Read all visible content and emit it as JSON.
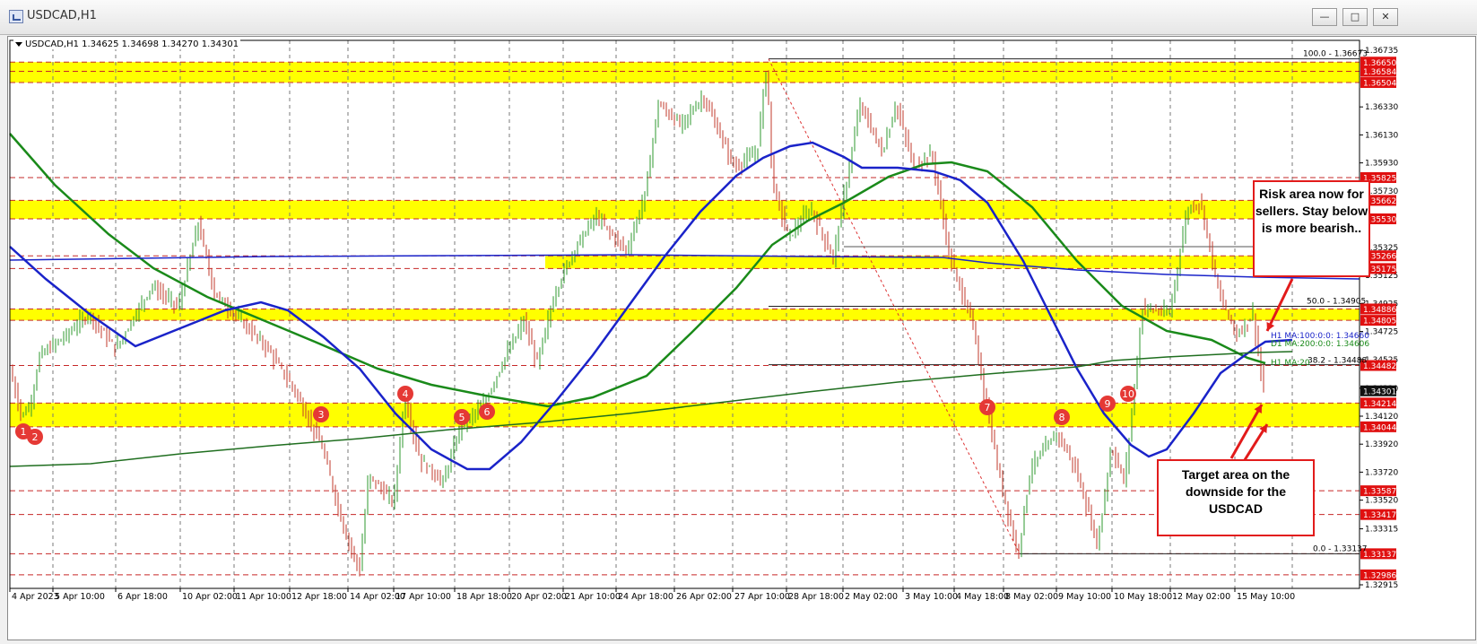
{
  "window": {
    "title": "USDCAD,H1",
    "buttons": [
      "minimize",
      "maximize",
      "close"
    ],
    "minimize_glyph": "—",
    "maximize_glyph": "□",
    "close_glyph": "✕"
  },
  "chart": {
    "info_line": "USDCAD,H1  1.34625 1.34698 1.34270 1.34301",
    "y_ticks": [
      "1.36735",
      "1.36330",
      "1.36130",
      "1.35930",
      "1.35730",
      "1.35325",
      "1.35125",
      "1.34925",
      "1.34725",
      "1.34525",
      "1.34320",
      "1.34120",
      "1.33920",
      "1.33720",
      "1.33520",
      "1.33315",
      "1.32915"
    ],
    "x_ticks": [
      "4 Apr 2023",
      "5 Apr 10:00",
      "6 Apr 18:00",
      "10 Apr 02:00",
      "11 Apr 10:00",
      "12 Apr 18:00",
      "14 Apr 02:00",
      "17 Apr 10:00",
      "18 Apr 18:00",
      "20 Apr 02:00",
      "21 Apr 10:00",
      "24 Apr 18:00",
      "26 Apr 02:00",
      "27 Apr 10:00",
      "28 Apr 18:00",
      "2 May 02:00",
      "3 May 10:00",
      "4 May 18:00",
      "8 May 02:00",
      "9 May 10:00",
      "10 May 18:00",
      "12 May 02:00",
      "15 May 10:00"
    ],
    "price_tags": [
      {
        "value": "1.36650",
        "color": "red"
      },
      {
        "value": "1.36584",
        "color": "red"
      },
      {
        "value": "1.36504",
        "color": "red"
      },
      {
        "value": "1.35825",
        "color": "red"
      },
      {
        "value": "1.35662",
        "color": "red"
      },
      {
        "value": "1.35530",
        "color": "red"
      },
      {
        "value": "1.35266",
        "color": "red"
      },
      {
        "value": "1.35175",
        "color": "red"
      },
      {
        "value": "1.34886",
        "color": "red"
      },
      {
        "value": "1.34805",
        "color": "red"
      },
      {
        "value": "1.34482",
        "color": "red"
      },
      {
        "value": "1.34301",
        "color": "black"
      },
      {
        "value": "1.34214",
        "color": "red"
      },
      {
        "value": "1.34044",
        "color": "red"
      },
      {
        "value": "1.33587",
        "color": "red"
      },
      {
        "value": "1.33417",
        "color": "red"
      },
      {
        "value": "1.33137",
        "color": "red"
      },
      {
        "value": "1.32986",
        "color": "red"
      }
    ],
    "fib_labels": {
      "f100": "100.0 - 1.36673",
      "f50": "50.0 - 1.34905",
      "f382": "38.2 - 1.34488",
      "f0": "0.0 - 1.33137"
    },
    "ma_labels": {
      "h1_100": "H1 MA:100:0:0: 1.34660",
      "d1_200": "D1 MA:200:0:0: 1.34606",
      "h1_200": "H1 MA:20"
    },
    "markers": [
      "1",
      "2",
      "3",
      "4",
      "5",
      "6",
      "7",
      "8",
      "9",
      "10"
    ],
    "colors": {
      "zone": "#ffff00",
      "ma_blue": "#1a23c9",
      "ma_green": "#1a8a1a",
      "ma_darkgreen": "#1f6e1f",
      "candle_up": "#2f9a2f",
      "candle_down": "#c0392b",
      "level_red": "#c62828",
      "marker": "#e53935"
    }
  },
  "annotations": {
    "risk": "Risk area now for sellers. Stay below is more bearish..",
    "target": "Target area on the downside for the USDCAD"
  }
}
